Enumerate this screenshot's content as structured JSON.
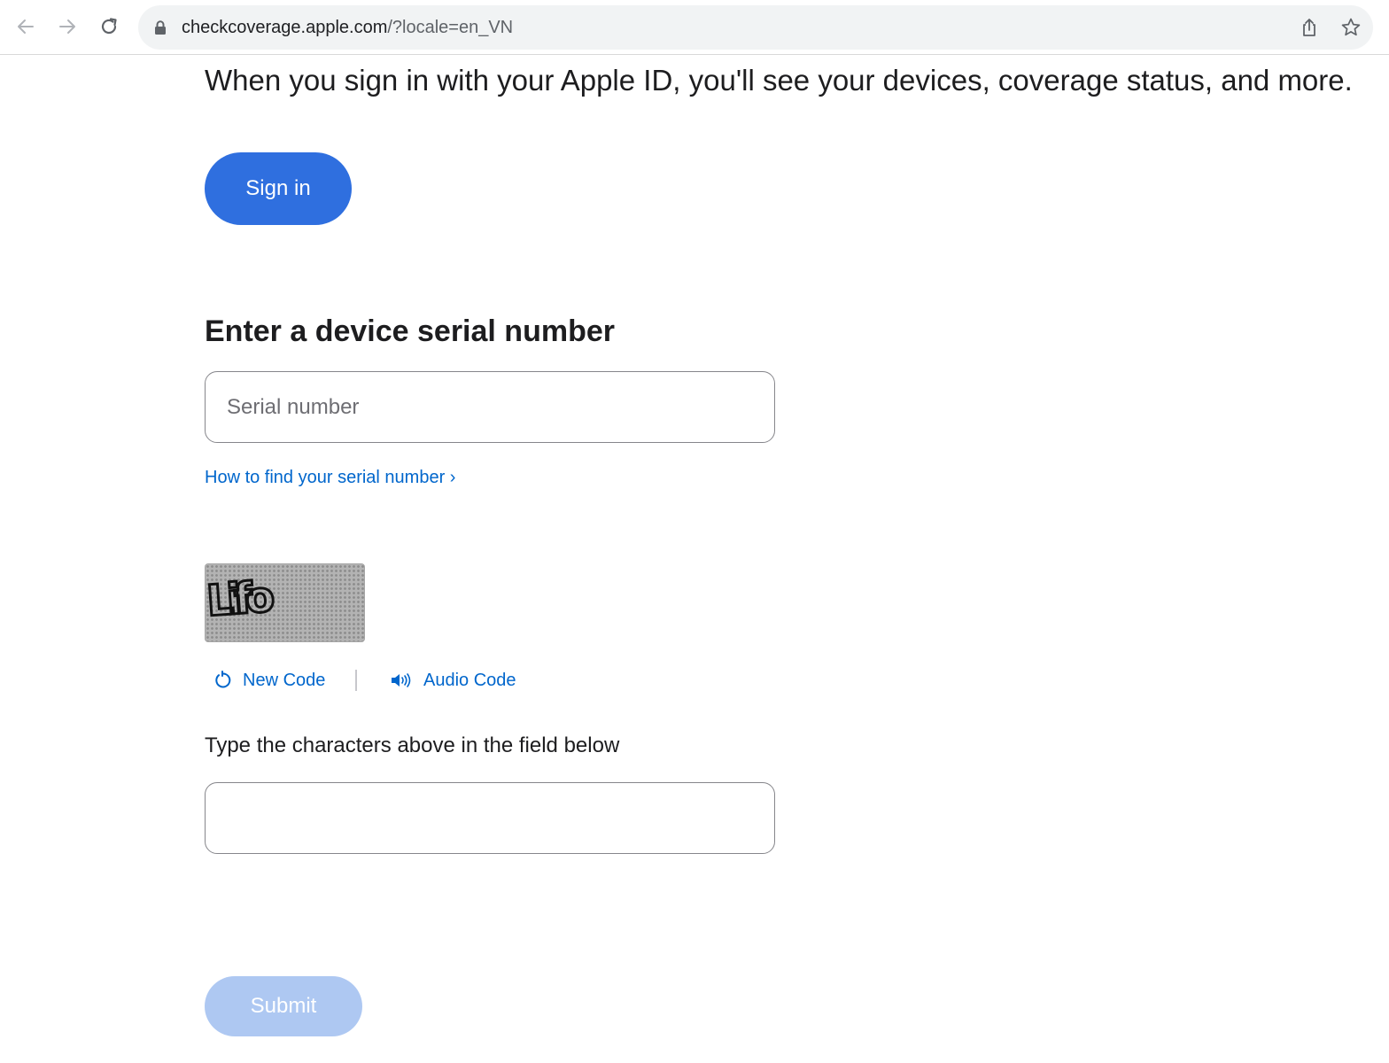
{
  "browser": {
    "url_host": "checkcoverage.apple.com",
    "url_rest": "/?locale=en_VN",
    "icons": {
      "back": "arrow-left-icon",
      "forward": "arrow-right-icon",
      "reload": "reload-icon",
      "lock": "lock-icon",
      "share": "share-icon",
      "bookmark": "star-icon"
    }
  },
  "page": {
    "intro_text": "When you sign in with your Apple ID, you'll see your devices, coverage status, and more.",
    "signin_label": "Sign in",
    "serial_heading": "Enter a device serial number",
    "serial_placeholder": "Serial number",
    "serial_value": "",
    "find_serial_link": "How to find your serial number ›",
    "captcha_text": "Lifo",
    "new_code_label": "New Code",
    "audio_code_label": "Audio Code",
    "captcha_instruction": "Type the characters above in the field below",
    "captcha_value": "",
    "submit_label": "Submit"
  },
  "colors": {
    "primary_button": "#2f6fdf",
    "disabled_button": "#aec8f2",
    "link": "#0066cc",
    "text": "#1d1d1f"
  }
}
